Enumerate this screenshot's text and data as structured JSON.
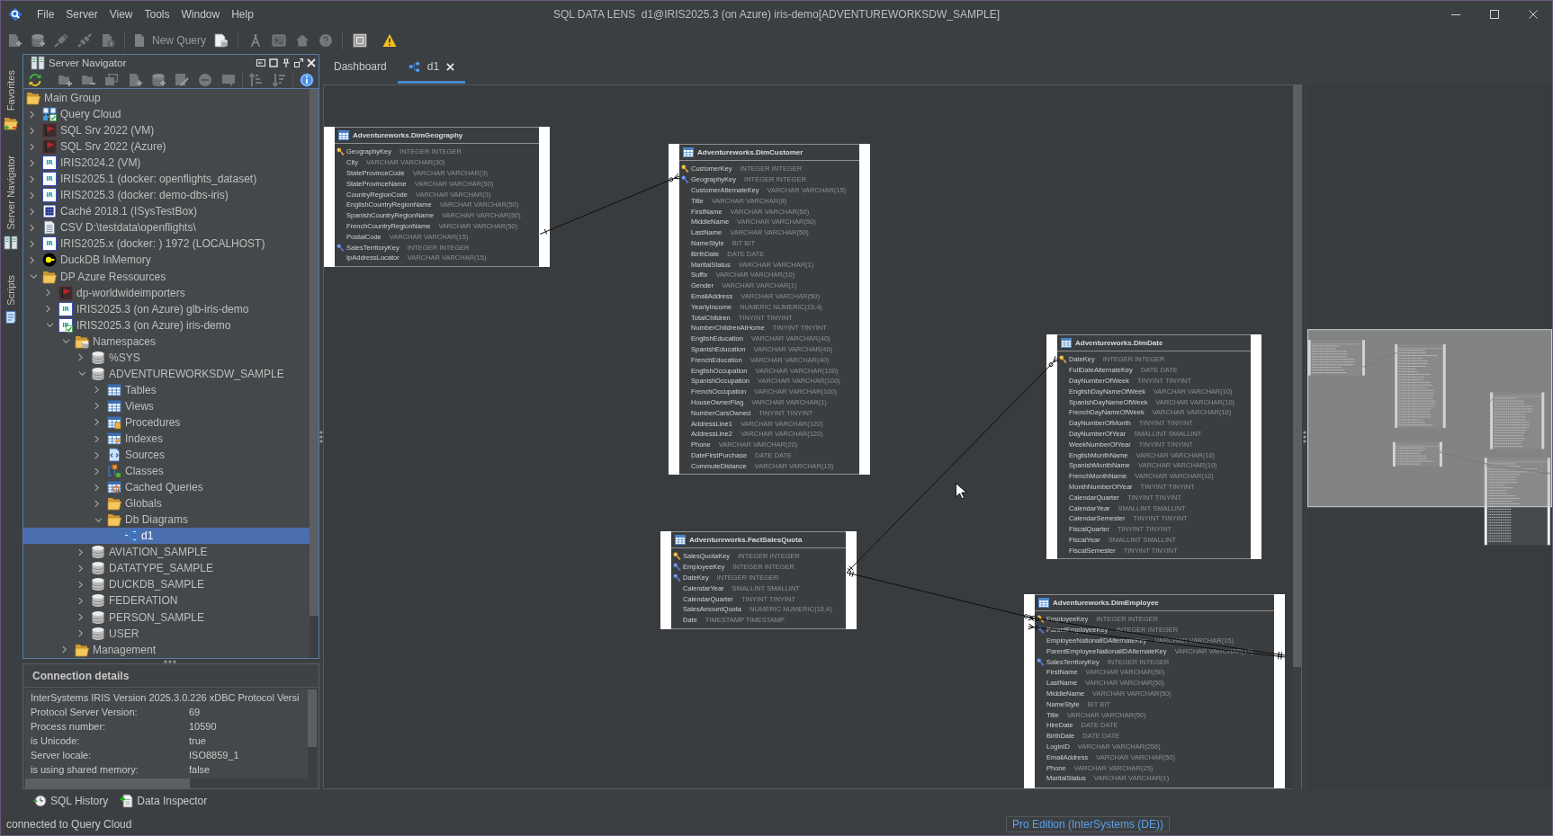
{
  "window": {
    "title": "SQL DATA LENS  d1@IRIS2025.3 (on Azure) iris-demo[ADVENTUREWORKSDW_SAMPLE]"
  },
  "menu": [
    "File",
    "Server",
    "View",
    "Tools",
    "Window",
    "Help"
  ],
  "toolbar": {
    "new_query": "New Query"
  },
  "side_tabs": [
    {
      "label": "Favorites",
      "kind": "favorites"
    },
    {
      "label": "Server Navigator",
      "kind": "servers"
    },
    {
      "label": "Scripts",
      "kind": "scripts"
    }
  ],
  "navigator": {
    "title": "Server Navigator",
    "tree": [
      {
        "label": "Main Group",
        "kind": "folder",
        "selected": false,
        "children": [
          {
            "label": "Query Cloud",
            "kind": "cloud",
            "expanded": false,
            "selected": false,
            "connected": true
          },
          {
            "label": "SQL Srv 2022 (VM)",
            "kind": "mssql",
            "expanded": false,
            "selected": false
          },
          {
            "label": "SQL Srv 2022 (Azure)",
            "kind": "mssql",
            "expanded": false,
            "selected": false
          },
          {
            "label": "IRIS2024.2 (VM)",
            "kind": "iris",
            "badge": "IR",
            "expanded": false,
            "selected": false
          },
          {
            "label": "IRIS2025.1 (docker: openflights_dataset)",
            "kind": "iris",
            "badge": "IR",
            "expanded": false,
            "selected": false
          },
          {
            "label": "IRIS2025.3 (docker: demo-dbs-iris)",
            "kind": "iris",
            "badge": "IR",
            "expanded": false,
            "selected": false
          },
          {
            "label": "Caché 2018.1 (ISysTestBox)",
            "kind": "cache",
            "expanded": false,
            "selected": false
          },
          {
            "label": "CSV D:\\testdata\\openflights\\",
            "kind": "csv",
            "expanded": false,
            "selected": false
          },
          {
            "label": "IRIS2025.x (docker: ) 1972 (LOCALHOST)",
            "kind": "iris",
            "badge": "IR",
            "expanded": false,
            "selected": false
          },
          {
            "label": "DuckDB InMemory",
            "kind": "duckdb",
            "expanded": false,
            "selected": false
          },
          {
            "label": "DP Azure Ressources",
            "kind": "folder",
            "expanded": true,
            "selected": false,
            "children": [
              {
                "label": "dp-worldwideimporters",
                "kind": "mssql",
                "expanded": false,
                "selected": false
              },
              {
                "label": "IRIS2025.3 (on Azure) glb-iris-demo",
                "kind": "iris",
                "badge": "IR",
                "expanded": false,
                "selected": false
              },
              {
                "label": "IRIS2025.3 (on Azure) iris-demo",
                "kind": "iris",
                "badge": "IR",
                "connected": true,
                "expanded": true,
                "selected": false,
                "children": [
                  {
                    "label": "Namespaces",
                    "kind": "namespaces",
                    "expanded": true,
                    "selected": false,
                    "children": [
                      {
                        "label": "%SYS",
                        "kind": "db",
                        "expanded": false,
                        "selected": false
                      },
                      {
                        "label": "ADVENTUREWORKSDW_SAMPLE",
                        "kind": "db",
                        "expanded": true,
                        "selected": false,
                        "children": [
                          {
                            "label": "Tables",
                            "kind": "table",
                            "expanded": false,
                            "selected": false
                          },
                          {
                            "label": "Views",
                            "kind": "view",
                            "expanded": false,
                            "selected": false
                          },
                          {
                            "label": "Procedures",
                            "kind": "procedure",
                            "expanded": false,
                            "selected": false
                          },
                          {
                            "label": "Indexes",
                            "kind": "index",
                            "expanded": false,
                            "selected": false
                          },
                          {
                            "label": "Sources",
                            "kind": "source",
                            "expanded": false,
                            "selected": false
                          },
                          {
                            "label": "Classes",
                            "kind": "class",
                            "expanded": false,
                            "selected": false
                          },
                          {
                            "label": "Cached Queries",
                            "kind": "cachedquery",
                            "expanded": false,
                            "selected": false
                          },
                          {
                            "label": "Globals",
                            "kind": "folder",
                            "expanded": false,
                            "selected": false
                          },
                          {
                            "label": "Db Diagrams",
                            "kind": "folder",
                            "expanded": true,
                            "selected": false,
                            "children": [
                              {
                                "label": "d1",
                                "kind": "diagram",
                                "selected": true
                              }
                            ]
                          }
                        ]
                      },
                      {
                        "label": "AVIATION_SAMPLE",
                        "kind": "db",
                        "expanded": false,
                        "selected": false
                      },
                      {
                        "label": "DATATYPE_SAMPLE",
                        "kind": "db",
                        "expanded": false,
                        "selected": false
                      },
                      {
                        "label": "DUCKDB_SAMPLE",
                        "kind": "db",
                        "expanded": false,
                        "selected": false
                      },
                      {
                        "label": "FEDERATION",
                        "kind": "db",
                        "expanded": false,
                        "selected": false
                      },
                      {
                        "label": "PERSON_SAMPLE",
                        "kind": "db",
                        "expanded": false,
                        "selected": false
                      },
                      {
                        "label": "USER",
                        "kind": "db",
                        "expanded": false,
                        "selected": false
                      }
                    ]
                  },
                  {
                    "label": "Management",
                    "kind": "folder",
                    "expanded": false,
                    "selected": false
                  }
                ]
              }
            ]
          }
        ]
      }
    ]
  },
  "connection_details": {
    "title": "Connection details",
    "version": "InterSystems IRIS Version 2025.3.0.226 xDBC Protocol Versi",
    "properties": [
      {
        "label": "Protocol Server Version:",
        "value": "69"
      },
      {
        "label": "Process number:",
        "value": "10590"
      },
      {
        "label": "is Unicode:",
        "value": "true"
      },
      {
        "label": "Server locale:",
        "value": "ISO8859_1"
      },
      {
        "label": "is using shared memory:",
        "value": "false"
      }
    ]
  },
  "bottom_tabs": [
    {
      "label": "SQL History",
      "kind": "history"
    },
    {
      "label": "Data Inspector",
      "kind": "inspector"
    }
  ],
  "editor_tabs": [
    {
      "label": "Dashboard",
      "kind": "dashboard",
      "selected": false,
      "closable": false
    },
    {
      "label": "d1",
      "kind": "diagram",
      "selected": true,
      "closable": true
    }
  ],
  "diagram": {
    "tables": [
      {
        "name": "Adventureworks.DimGeography",
        "columns": [
          {
            "name": "GeographyKey",
            "type": "INTEGER INTEGER",
            "kind": "primary_key"
          },
          {
            "name": "City",
            "type": "VARCHAR VARCHAR(30)"
          },
          {
            "name": "StateProvinceCode",
            "type": "VARCHAR VARCHAR(3)"
          },
          {
            "name": "StateProvinceName",
            "type": "VARCHAR VARCHAR(50)"
          },
          {
            "name": "CountryRegionCode",
            "type": "VARCHAR VARCHAR(3)"
          },
          {
            "name": "EnglishCountryRegionName",
            "type": "VARCHAR VARCHAR(50)"
          },
          {
            "name": "SpanishCountryRegionName",
            "type": "VARCHAR VARCHAR(50)"
          },
          {
            "name": "FrenchCountryRegionName",
            "type": "VARCHAR VARCHAR(50)"
          },
          {
            "name": "PostalCode",
            "type": "VARCHAR VARCHAR(15)"
          },
          {
            "name": "SalesTerritoryKey",
            "type": "INTEGER INTEGER",
            "kind": "foreign_key"
          },
          {
            "name": "IpAddressLocator",
            "type": "VARCHAR VARCHAR(15)"
          }
        ]
      },
      {
        "name": "Adventureworks.DimCustomer",
        "columns": [
          {
            "name": "CustomerKey",
            "type": "INTEGER INTEGER",
            "kind": "primary_key"
          },
          {
            "name": "GeographyKey",
            "type": "INTEGER INTEGER",
            "kind": "foreign_key"
          },
          {
            "name": "CustomerAlternateKey",
            "type": "VARCHAR VARCHAR(15)"
          },
          {
            "name": "Title",
            "type": "VARCHAR VARCHAR(8)"
          },
          {
            "name": "FirstName",
            "type": "VARCHAR VARCHAR(50)"
          },
          {
            "name": "MiddleName",
            "type": "VARCHAR VARCHAR(50)"
          },
          {
            "name": "LastName",
            "type": "VARCHAR VARCHAR(50)"
          },
          {
            "name": "NameStyle",
            "type": "BIT BIT"
          },
          {
            "name": "BirthDate",
            "type": "DATE DATE"
          },
          {
            "name": "MaritalStatus",
            "type": "VARCHAR VARCHAR(1)"
          },
          {
            "name": "Suffix",
            "type": "VARCHAR VARCHAR(10)"
          },
          {
            "name": "Gender",
            "type": "VARCHAR VARCHAR(1)"
          },
          {
            "name": "EmailAddress",
            "type": "VARCHAR VARCHAR(50)"
          },
          {
            "name": "YearlyIncome",
            "type": "NUMERIC NUMERIC(15,4)"
          },
          {
            "name": "TotalChildren",
            "type": "TINYINT TINYINT"
          },
          {
            "name": "NumberChildrenAtHome",
            "type": "TINYINT TINYINT"
          },
          {
            "name": "EnglishEducation",
            "type": "VARCHAR VARCHAR(40)"
          },
          {
            "name": "SpanishEducation",
            "type": "VARCHAR VARCHAR(40)"
          },
          {
            "name": "FrenchEducation",
            "type": "VARCHAR VARCHAR(40)"
          },
          {
            "name": "EnglishOccupation",
            "type": "VARCHAR VARCHAR(100)"
          },
          {
            "name": "SpanishOccupation",
            "type": "VARCHAR VARCHAR(100)"
          },
          {
            "name": "FrenchOccupation",
            "type": "VARCHAR VARCHAR(100)"
          },
          {
            "name": "HouseOwnerFlag",
            "type": "VARCHAR VARCHAR(1)"
          },
          {
            "name": "NumberCarsOwned",
            "type": "TINYINT TINYINT"
          },
          {
            "name": "AddressLine1",
            "type": "VARCHAR VARCHAR(120)"
          },
          {
            "name": "AddressLine2",
            "type": "VARCHAR VARCHAR(120)"
          },
          {
            "name": "Phone",
            "type": "VARCHAR VARCHAR(20)"
          },
          {
            "name": "DateFirstPurchase",
            "type": "DATE DATE"
          },
          {
            "name": "CommuteDistance",
            "type": "VARCHAR VARCHAR(15)"
          }
        ]
      },
      {
        "name": "Adventureworks.DimDate",
        "columns": [
          {
            "name": "DateKey",
            "type": "INTEGER INTEGER",
            "kind": "primary_key"
          },
          {
            "name": "FullDateAlternateKey",
            "type": "DATE DATE"
          },
          {
            "name": "DayNumberOfWeek",
            "type": "TINYINT TINYINT"
          },
          {
            "name": "EnglishDayNameOfWeek",
            "type": "VARCHAR VARCHAR(10)"
          },
          {
            "name": "SpanishDayNameOfWeek",
            "type": "VARCHAR VARCHAR(10)"
          },
          {
            "name": "FrenchDayNameOfWeek",
            "type": "VARCHAR VARCHAR(10)"
          },
          {
            "name": "DayNumberOfMonth",
            "type": "TINYINT TINYINT"
          },
          {
            "name": "DayNumberOfYear",
            "type": "SMALLINT SMALLINT"
          },
          {
            "name": "WeekNumberOfYear",
            "type": "TINYINT TINYINT"
          },
          {
            "name": "EnglishMonthName",
            "type": "VARCHAR VARCHAR(10)"
          },
          {
            "name": "SpanishMonthName",
            "type": "VARCHAR VARCHAR(10)"
          },
          {
            "name": "FrenchMonthName",
            "type": "VARCHAR VARCHAR(10)"
          },
          {
            "name": "MonthNumberOfYear",
            "type": "TINYINT TINYINT"
          },
          {
            "name": "CalendarQuarter",
            "type": "TINYINT TINYINT"
          },
          {
            "name": "CalendarYear",
            "type": "SMALLINT SMALLINT"
          },
          {
            "name": "CalendarSemester",
            "type": "TINYINT TINYINT"
          },
          {
            "name": "FiscalQuarter",
            "type": "TINYINT TINYINT"
          },
          {
            "name": "FiscalYear",
            "type": "SMALLINT SMALLINT"
          },
          {
            "name": "FiscalSemester",
            "type": "TINYINT TINYINT"
          }
        ]
      },
      {
        "name": "Adventureworks.FactSalesQuota",
        "columns": [
          {
            "name": "SalesQuotaKey",
            "type": "INTEGER INTEGER",
            "kind": "primary_key"
          },
          {
            "name": "EmployeeKey",
            "type": "INTEGER INTEGER",
            "kind": "foreign_key"
          },
          {
            "name": "DateKey",
            "type": "INTEGER INTEGER",
            "kind": "foreign_key"
          },
          {
            "name": "CalendarYear",
            "type": "SMALLINT SMALLINT"
          },
          {
            "name": "CalendarQuarter",
            "type": "TINYINT TINYINT"
          },
          {
            "name": "SalesAmountQuota",
            "type": "NUMERIC NUMERIC(15,4)"
          },
          {
            "name": "Date",
            "type": "TIMESTAMP TIMESTAMP"
          }
        ]
      },
      {
        "name": "Adventureworks.DimEmployee",
        "columns": [
          {
            "name": "EmployeeKey",
            "type": "INTEGER INTEGER",
            "kind": "primary_key"
          },
          {
            "name": "ParentEmployeeKey",
            "type": "INTEGER INTEGER",
            "kind": "foreign_key"
          },
          {
            "name": "EmployeeNationalIDAlternateKey",
            "type": "VARCHAR VARCHAR(15)"
          },
          {
            "name": "ParentEmployeeNationalIDAlternateKey",
            "type": "VARCHAR VARCHAR(15)"
          },
          {
            "name": "SalesTerritoryKey",
            "type": "INTEGER INTEGER",
            "kind": "foreign_key"
          },
          {
            "name": "FirstName",
            "type": "VARCHAR VARCHAR(50)"
          },
          {
            "name": "LastName",
            "type": "VARCHAR VARCHAR(50)"
          },
          {
            "name": "MiddleName",
            "type": "VARCHAR VARCHAR(50)"
          },
          {
            "name": "NameStyle",
            "type": "BIT BIT"
          },
          {
            "name": "Title",
            "type": "VARCHAR VARCHAR(50)"
          },
          {
            "name": "HireDate",
            "type": "DATE DATE"
          },
          {
            "name": "BirthDate",
            "type": "DATE DATE"
          },
          {
            "name": "LoginID",
            "type": "VARCHAR VARCHAR(256)"
          },
          {
            "name": "EmailAddress",
            "type": "VARCHAR VARCHAR(50)"
          },
          {
            "name": "Phone",
            "type": "VARCHAR VARCHAR(25)"
          },
          {
            "name": "MaritalStatus",
            "type": "VARCHAR VARCHAR(1)"
          }
        ]
      }
    ]
  },
  "status_bar": {
    "message": "connected to Query Cloud",
    "edition": "Pro Edition (InterSystems (DE))"
  }
}
